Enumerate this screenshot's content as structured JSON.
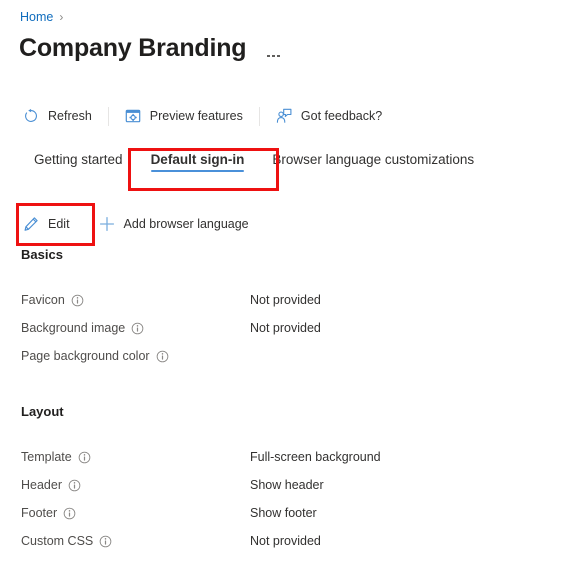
{
  "breadcrumb": {
    "home_label": "Home",
    "separator": "›"
  },
  "header": {
    "title": "Company Branding",
    "more_menu_name": "more-options"
  },
  "commandbar": {
    "items": [
      {
        "label": "Refresh",
        "icon": "refresh-icon"
      },
      {
        "label": "Preview features",
        "icon": "preview-features-icon"
      },
      {
        "label": "Got feedback?",
        "icon": "feedback-icon"
      }
    ]
  },
  "tabs": [
    {
      "label": "Getting started",
      "active": false
    },
    {
      "label": "Default sign-in",
      "active": true
    },
    {
      "label": "Browser language customizations",
      "active": false
    }
  ],
  "actionbar": {
    "edit": {
      "label": "Edit",
      "icon": "pencil-icon"
    },
    "add_language": {
      "label": "Add browser language",
      "icon": "plus-icon"
    }
  },
  "basics": {
    "heading": "Basics",
    "rows": [
      {
        "label": "Favicon",
        "value": "Not provided"
      },
      {
        "label": "Background image",
        "value": "Not provided"
      },
      {
        "label": "Page background color",
        "value": ""
      }
    ]
  },
  "layout": {
    "heading": "Layout",
    "rows": [
      {
        "label": "Template",
        "value": "Full-screen background"
      },
      {
        "label": "Header",
        "value": "Show header"
      },
      {
        "label": "Footer",
        "value": "Show footer"
      },
      {
        "label": "Custom CSS",
        "value": "Not provided"
      }
    ]
  },
  "colors": {
    "link": "#0f6cbd",
    "tab_underline": "#4a90d9",
    "icon_blue": "#4a8fd4",
    "annotation_red": "#ee1111",
    "text": "#323130",
    "muted_text": "#4f4d4b"
  }
}
